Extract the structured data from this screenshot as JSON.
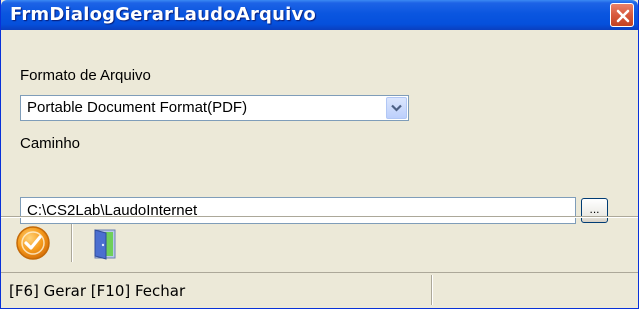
{
  "window": {
    "title": "FrmDialogGerarLaudoArquivo",
    "close_icon": "close-icon"
  },
  "form": {
    "format_label": "Formato de Arquivo",
    "format_value": "Portable Document Format(PDF)",
    "path_label": "Caminho",
    "path_value": "C:\\CS2Lab\\LaudoInternet",
    "browse_label": "..."
  },
  "toolbar": {
    "generate_icon": "checkmark-circle-icon",
    "close_icon": "exit-door-icon"
  },
  "statusbar": {
    "text": "[F6] Gerar [F10] Fechar"
  },
  "colors": {
    "titlebar": "#0550dc",
    "window_bg": "#ece9d8",
    "close_button": "#d8593d",
    "generate_orange": "#f59a1b"
  }
}
